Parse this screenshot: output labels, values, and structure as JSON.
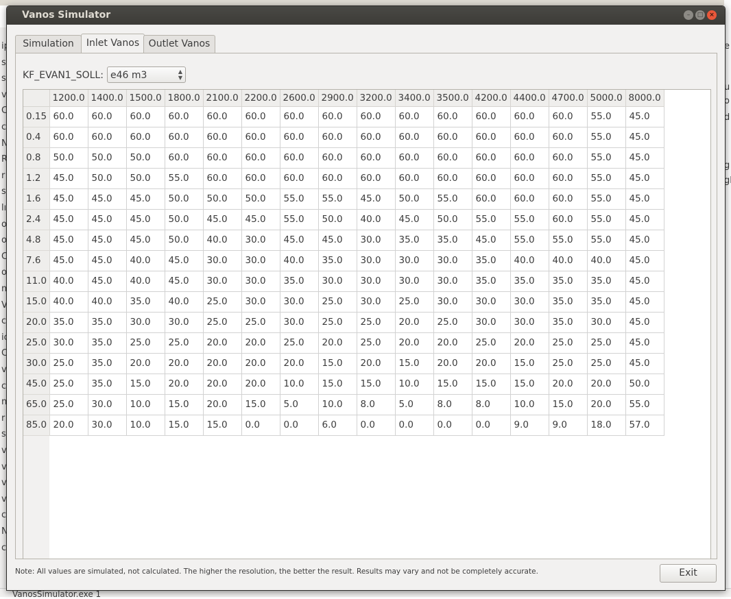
{
  "window": {
    "title": "Vanos Simulator"
  },
  "tabs": [
    {
      "label": "Simulation"
    },
    {
      "label": "Inlet Vanos"
    },
    {
      "label": "Outlet Vanos"
    }
  ],
  "map_selector": {
    "label": "KF_EVAN1_SOLL:",
    "value": "e46 m3"
  },
  "table": {
    "columns": [
      "1200.0",
      "1400.0",
      "1500.0",
      "1800.0",
      "2100.0",
      "2200.0",
      "2600.0",
      "2900.0",
      "3200.0",
      "3400.0",
      "3500.0",
      "4200.0",
      "4400.0",
      "4700.0",
      "5000.0",
      "8000.0"
    ],
    "rows": [
      {
        "label": "0.15",
        "values": [
          "60.0",
          "60.0",
          "60.0",
          "60.0",
          "60.0",
          "60.0",
          "60.0",
          "60.0",
          "60.0",
          "60.0",
          "60.0",
          "60.0",
          "60.0",
          "60.0",
          "55.0",
          "45.0"
        ]
      },
      {
        "label": "0.4",
        "values": [
          "60.0",
          "60.0",
          "60.0",
          "60.0",
          "60.0",
          "60.0",
          "60.0",
          "60.0",
          "60.0",
          "60.0",
          "60.0",
          "60.0",
          "60.0",
          "60.0",
          "55.0",
          "45.0"
        ]
      },
      {
        "label": "0.8",
        "values": [
          "50.0",
          "50.0",
          "50.0",
          "60.0",
          "60.0",
          "60.0",
          "60.0",
          "60.0",
          "60.0",
          "60.0",
          "60.0",
          "60.0",
          "60.0",
          "60.0",
          "55.0",
          "45.0"
        ]
      },
      {
        "label": "1.2",
        "values": [
          "45.0",
          "50.0",
          "50.0",
          "55.0",
          "60.0",
          "60.0",
          "60.0",
          "60.0",
          "60.0",
          "60.0",
          "60.0",
          "60.0",
          "60.0",
          "60.0",
          "55.0",
          "45.0"
        ]
      },
      {
        "label": "1.6",
        "values": [
          "45.0",
          "45.0",
          "45.0",
          "50.0",
          "50.0",
          "50.0",
          "55.0",
          "55.0",
          "45.0",
          "50.0",
          "55.0",
          "60.0",
          "60.0",
          "60.0",
          "55.0",
          "45.0"
        ]
      },
      {
        "label": "2.4",
        "values": [
          "45.0",
          "45.0",
          "45.0",
          "50.0",
          "45.0",
          "45.0",
          "55.0",
          "50.0",
          "40.0",
          "45.0",
          "50.0",
          "55.0",
          "55.0",
          "60.0",
          "55.0",
          "45.0"
        ]
      },
      {
        "label": "4.8",
        "values": [
          "45.0",
          "45.0",
          "45.0",
          "50.0",
          "40.0",
          "30.0",
          "45.0",
          "45.0",
          "30.0",
          "35.0",
          "35.0",
          "45.0",
          "55.0",
          "55.0",
          "55.0",
          "45.0"
        ]
      },
      {
        "label": "7.6",
        "values": [
          "45.0",
          "45.0",
          "40.0",
          "45.0",
          "30.0",
          "30.0",
          "40.0",
          "35.0",
          "30.0",
          "30.0",
          "30.0",
          "35.0",
          "40.0",
          "40.0",
          "40.0",
          "45.0"
        ]
      },
      {
        "label": "11.0",
        "values": [
          "40.0",
          "45.0",
          "40.0",
          "45.0",
          "30.0",
          "30.0",
          "35.0",
          "30.0",
          "30.0",
          "30.0",
          "30.0",
          "35.0",
          "35.0",
          "35.0",
          "35.0",
          "45.0"
        ]
      },
      {
        "label": "15.0",
        "values": [
          "40.0",
          "40.0",
          "35.0",
          "40.0",
          "25.0",
          "30.0",
          "30.0",
          "25.0",
          "30.0",
          "25.0",
          "30.0",
          "30.0",
          "30.0",
          "35.0",
          "35.0",
          "45.0"
        ]
      },
      {
        "label": "20.0",
        "values": [
          "35.0",
          "35.0",
          "30.0",
          "30.0",
          "25.0",
          "25.0",
          "30.0",
          "25.0",
          "25.0",
          "20.0",
          "25.0",
          "30.0",
          "30.0",
          "35.0",
          "30.0",
          "45.0"
        ]
      },
      {
        "label": "25.0",
        "values": [
          "30.0",
          "35.0",
          "25.0",
          "25.0",
          "20.0",
          "20.0",
          "25.0",
          "20.0",
          "25.0",
          "20.0",
          "20.0",
          "25.0",
          "20.0",
          "25.0",
          "25.0",
          "45.0"
        ]
      },
      {
        "label": "30.0",
        "values": [
          "25.0",
          "35.0",
          "20.0",
          "20.0",
          "20.0",
          "20.0",
          "20.0",
          "15.0",
          "20.0",
          "15.0",
          "20.0",
          "20.0",
          "15.0",
          "25.0",
          "25.0",
          "45.0"
        ]
      },
      {
        "label": "45.0",
        "values": [
          "25.0",
          "35.0",
          "15.0",
          "20.0",
          "20.0",
          "20.0",
          "10.0",
          "15.0",
          "15.0",
          "10.0",
          "15.0",
          "15.0",
          "15.0",
          "20.0",
          "20.0",
          "50.0"
        ]
      },
      {
        "label": "65.0",
        "values": [
          "25.0",
          "30.0",
          "10.0",
          "15.0",
          "20.0",
          "15.0",
          "5.0",
          "10.0",
          "8.0",
          "5.0",
          "8.0",
          "8.0",
          "10.0",
          "15.0",
          "20.0",
          "55.0"
        ]
      },
      {
        "label": "85.0",
        "values": [
          "20.0",
          "30.0",
          "10.0",
          "15.0",
          "15.0",
          "0.0",
          "0.0",
          "6.0",
          "0.0",
          "0.0",
          "0.0",
          "0.0",
          "9.0",
          "9.0",
          "18.0",
          "57.0"
        ]
      }
    ]
  },
  "footer": {
    "note": "Note: All values are simulated, not calculated. The higher the resolution, the better the result. Results may vary and not be completely accurate.",
    "exit_label": "Exit"
  },
  "background": {
    "left_letters": [
      "ip",
      "s",
      "s",
      "v",
      "C",
      "c",
      "N",
      "R",
      "r",
      "s",
      "lı",
      "o",
      "o",
      "C",
      "ot",
      "m",
      "V",
      "c",
      "ic",
      "C",
      "v",
      "c",
      "n",
      "r",
      "s",
      "v",
      "v",
      "v",
      "v",
      "c",
      "N",
      "c"
    ],
    "right_letters": [
      "e",
      "u",
      "o",
      "d",
      "g",
      "gl"
    ],
    "bottom_text": "VanosSimulator.exe 1"
  }
}
